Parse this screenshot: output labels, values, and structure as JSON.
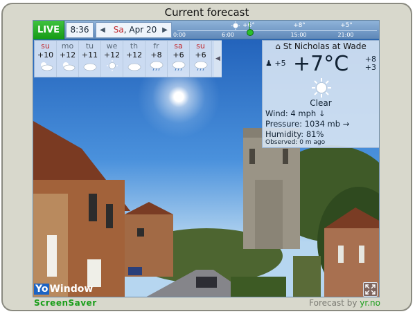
{
  "window": {
    "title": "Current forecast"
  },
  "topbar": {
    "live_label": "LIVE",
    "time": "8:36",
    "date": {
      "weekday": "Sa",
      "rest": ", Apr 20"
    },
    "timeline": {
      "temps": [
        "+6°",
        "+8°",
        "+5°"
      ],
      "hours": [
        "0:00",
        "6:00",
        "",
        "15:00",
        "21:00"
      ]
    }
  },
  "forecast": {
    "days": [
      {
        "name": "su",
        "temp": "+10",
        "weekend": true,
        "icon": "partly-cloudy-icon"
      },
      {
        "name": "mo",
        "temp": "+12",
        "weekend": false,
        "icon": "partly-cloudy-icon"
      },
      {
        "name": "tu",
        "temp": "+11",
        "weekend": false,
        "icon": "cloud-icon"
      },
      {
        "name": "we",
        "temp": "+12",
        "weekend": false,
        "icon": "sun-icon"
      },
      {
        "name": "th",
        "temp": "+12",
        "weekend": false,
        "icon": "cloud-icon"
      },
      {
        "name": "fr",
        "temp": "+8",
        "weekend": false,
        "icon": "rain-icon"
      },
      {
        "name": "sa",
        "temp": "+6",
        "weekend": true,
        "icon": "rain-icon"
      },
      {
        "name": "su",
        "temp": "+6",
        "weekend": true,
        "icon": "rain-icon"
      }
    ],
    "arrow": "◀"
  },
  "current": {
    "location": "St Nicholas at Wade",
    "temperature": "+7°C",
    "feels_like": "+5",
    "max": "+8",
    "min": "+3",
    "condition": "Clear",
    "wind": "Wind:  4 mph ↓",
    "pressure": "Pressure:  1034 mb →",
    "humidity": "Humidity:  81%",
    "observed": "Observed:   0 m ago"
  },
  "footer": {
    "brand_yo": "Yo",
    "brand_window": "Window",
    "screensaver": "ScreenSaver",
    "credit_prefix": "Forecast by ",
    "credit_source": "yr.no"
  },
  "colors": {
    "live": "#159a15",
    "weekend": "#c0282d",
    "brand_green": "#1a9e1a"
  }
}
